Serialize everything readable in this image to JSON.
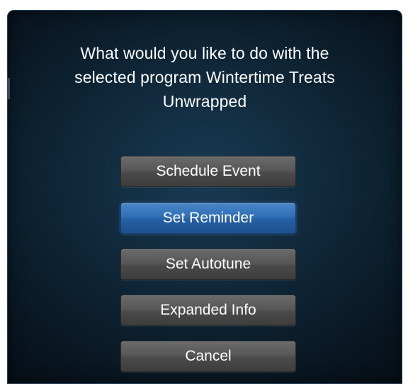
{
  "dialog": {
    "prompt_lines": [
      "What would you like to do with the",
      "selected program Wintertime Treats",
      "Unwrapped"
    ],
    "options": [
      {
        "label": "Schedule Event",
        "selected": false
      },
      {
        "label": "Set Reminder",
        "selected": true
      },
      {
        "label": "Set Autotune",
        "selected": false
      },
      {
        "label": "Expanded Info",
        "selected": false
      },
      {
        "label": "Cancel",
        "selected": false
      }
    ]
  },
  "colors": {
    "background_dark": "#0e2536",
    "button_gray": "#585858",
    "button_selected_blue": "#2f6fb6",
    "text": "#ffffff"
  }
}
